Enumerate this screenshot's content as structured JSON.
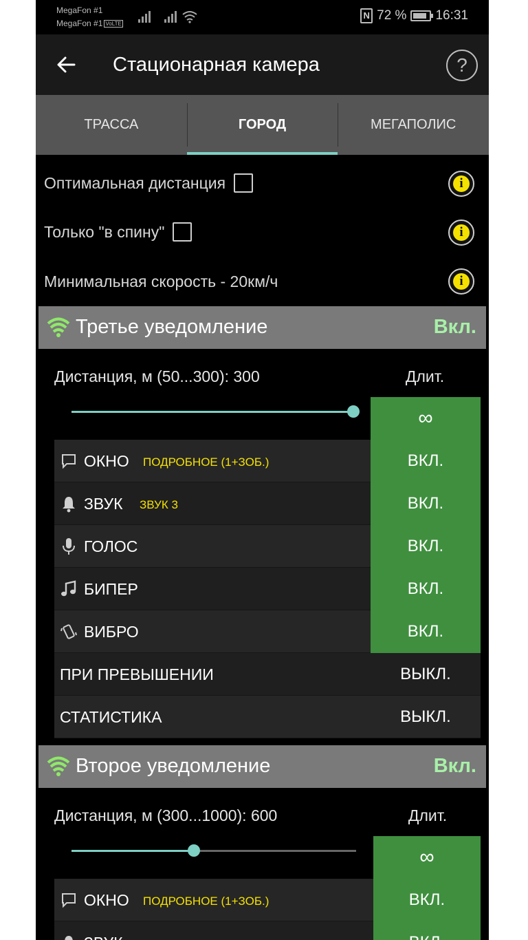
{
  "status": {
    "carrier1": "MegaFon #1",
    "carrier2": "MegaFon #1",
    "volte": "VoLTE",
    "battery": "72 %",
    "time": "16:31"
  },
  "appbar": {
    "title": "Стационарная камера"
  },
  "tabs": [
    {
      "label": "ТРАССА"
    },
    {
      "label": "ГОРОД"
    },
    {
      "label": "МЕГАПОЛИС"
    }
  ],
  "settings": {
    "optimal_distance": "Оптимальная дистанция",
    "only_back": "Только \"в спину\"",
    "min_speed": "Минимальная скорость - 20км/ч"
  },
  "third": {
    "title": "Третье уведомление",
    "state": "Вкл.",
    "distance_label": "Дистанция, м (50...300): 300",
    "duration_label": "Длит.",
    "duration_value": "∞",
    "slider_fraction": 1.0,
    "rows": [
      {
        "label": "ОКНО",
        "sub": "ПОДРОБНОЕ (1+ЗОБ.)",
        "value": "ВКЛ."
      },
      {
        "label": "ЗВУК",
        "sub": "ЗВУК 3",
        "value": "ВКЛ."
      },
      {
        "label": "ГОЛОС",
        "value": "ВКЛ."
      },
      {
        "label": "БИПЕР",
        "value": "ВКЛ."
      },
      {
        "label": "ВИБРО",
        "value": "ВКЛ."
      },
      {
        "label": "ПРИ ПРЕВЫШЕНИИ",
        "value": "ВЫКЛ."
      },
      {
        "label": "СТАТИСТИКА",
        "value": "ВЫКЛ."
      }
    ]
  },
  "second": {
    "title": "Второе уведомление",
    "state": "Вкл.",
    "distance_label": "Дистанция, м (300...1000): 600",
    "duration_label": "Длит.",
    "duration_value": "∞",
    "slider_fraction": 0.43,
    "rows": [
      {
        "label": "ОКНО",
        "sub": "ПОДРОБНОЕ (1+ЗОБ.)",
        "value": "ВКЛ."
      },
      {
        "label": "ЗВУК",
        "value": "ВКЛ."
      }
    ]
  }
}
